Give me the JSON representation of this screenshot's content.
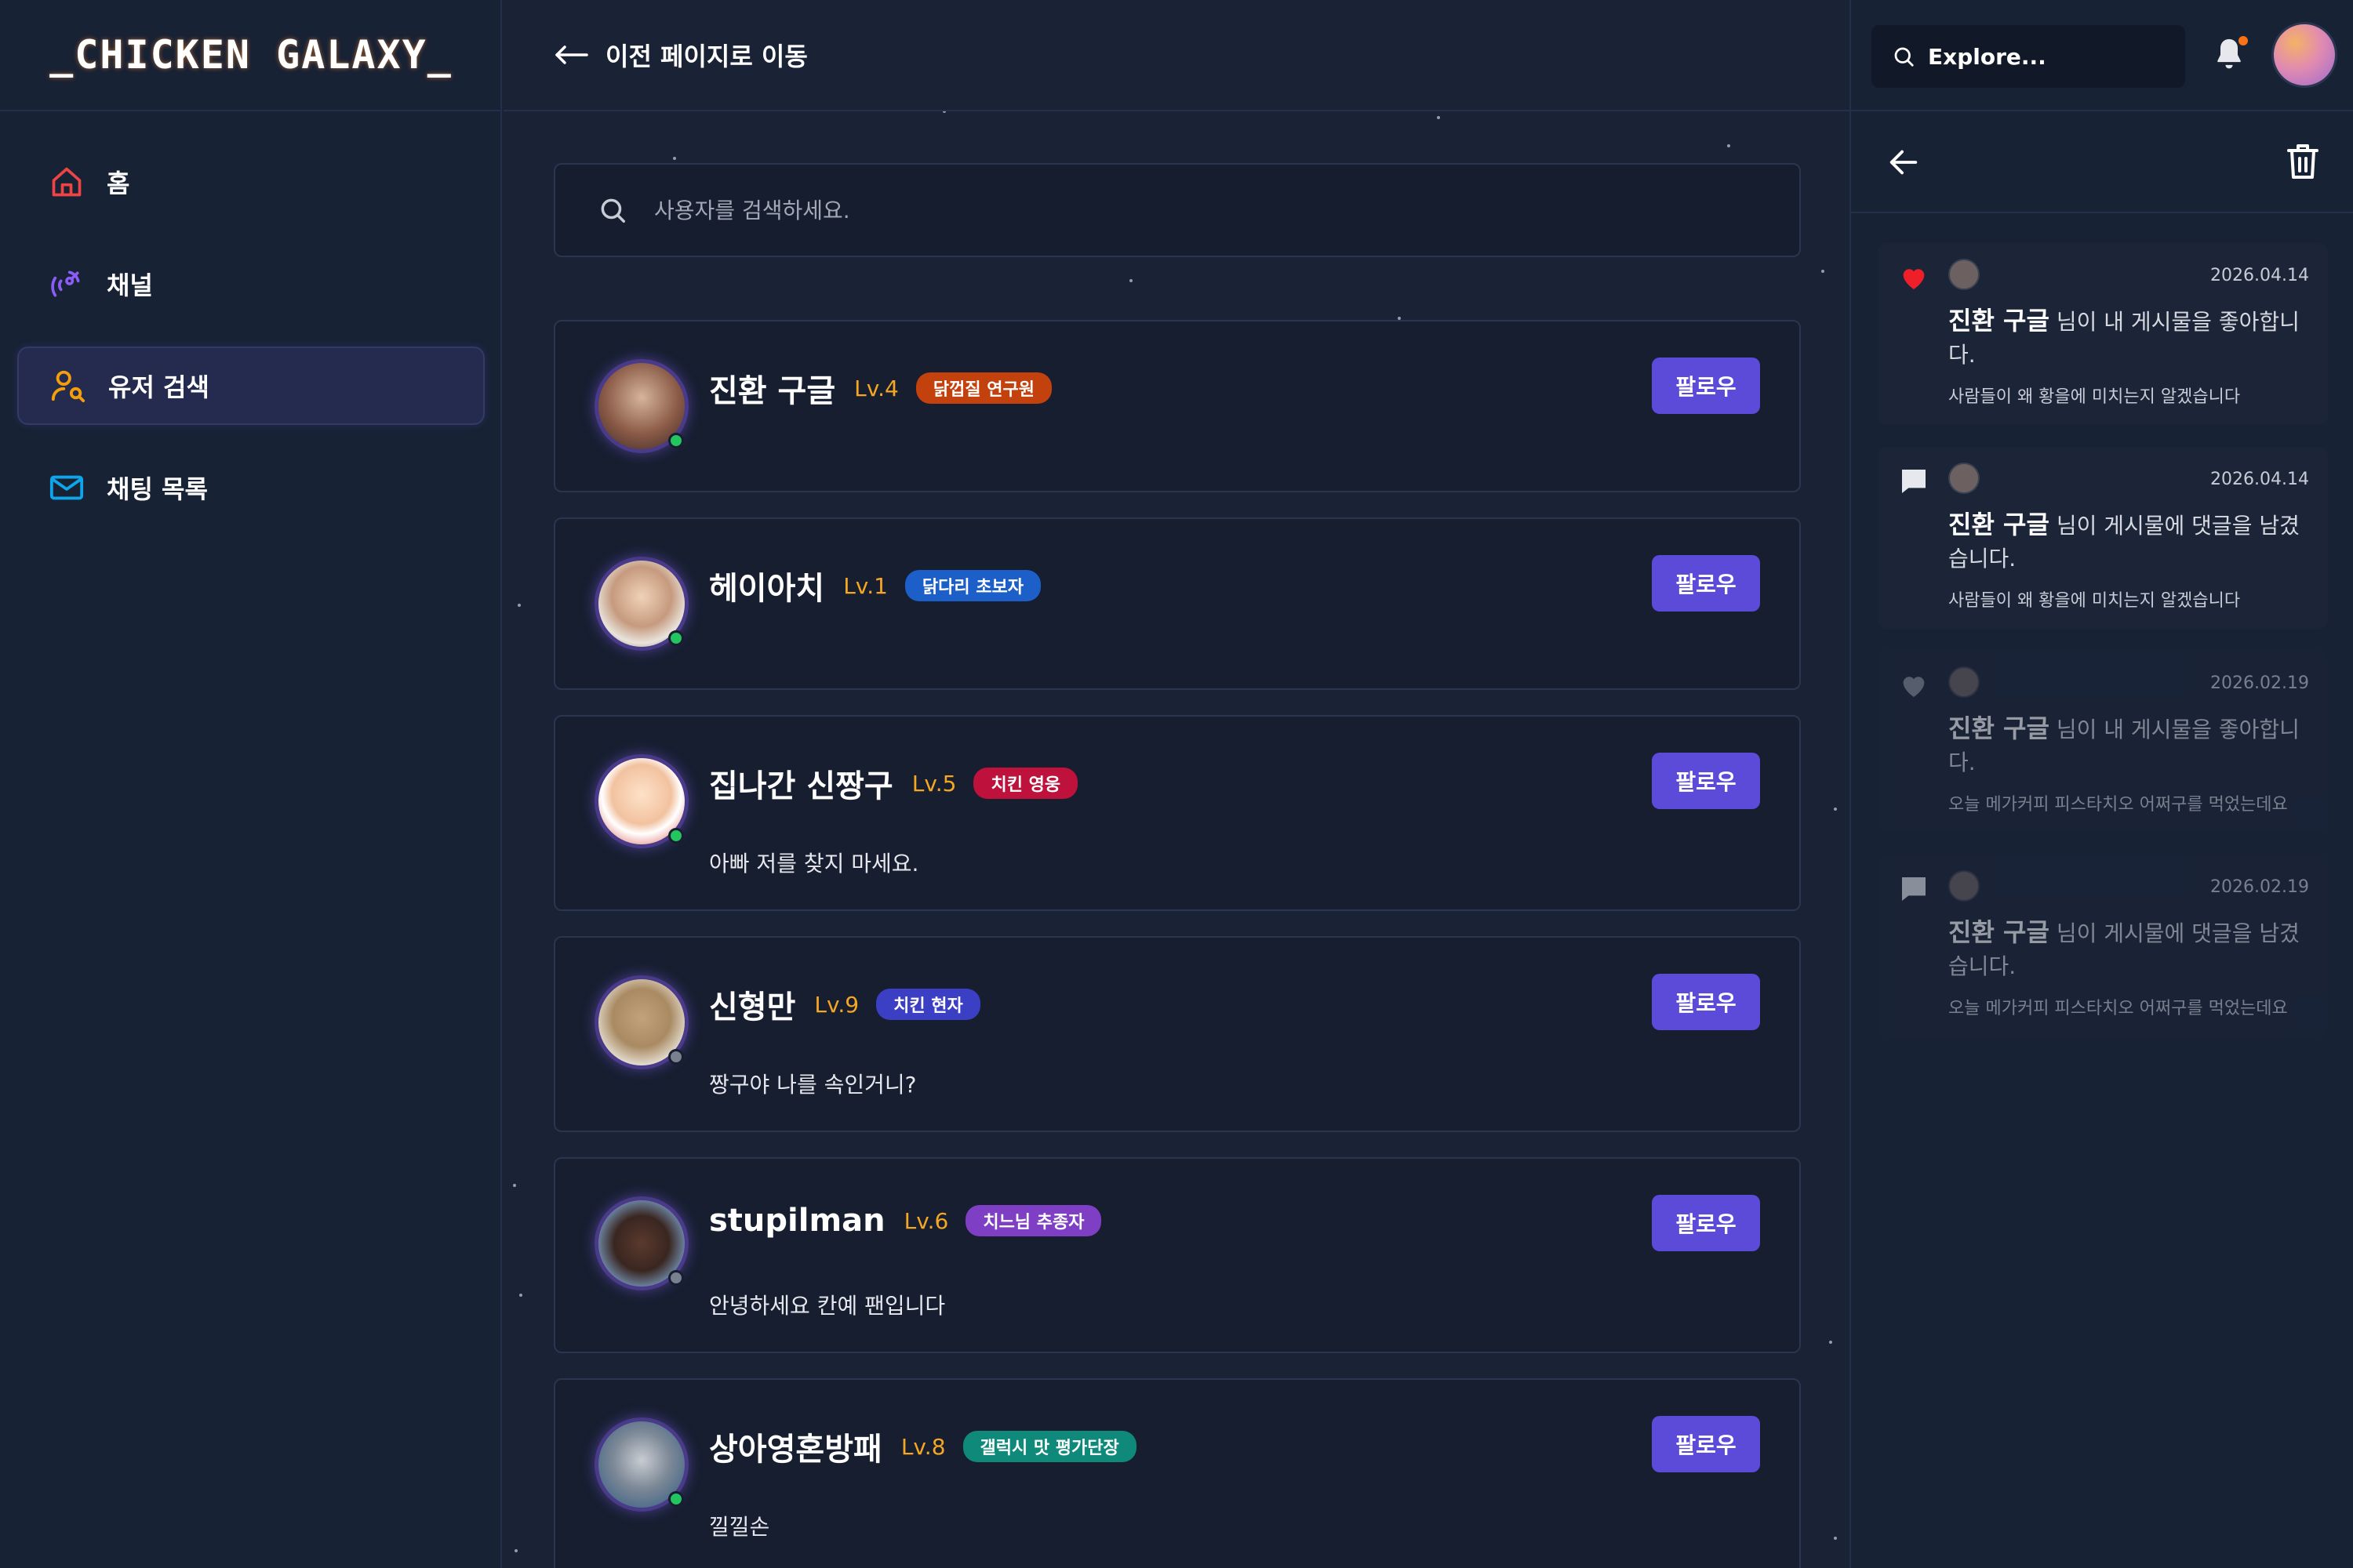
{
  "app": {
    "logo": "_CHICKEN GALAXY_"
  },
  "sidebar": {
    "items": [
      {
        "label": "홈",
        "icon": "home-icon"
      },
      {
        "label": "채널",
        "icon": "satellite-icon"
      },
      {
        "label": "유저 검색",
        "icon": "user-search-icon",
        "active": true
      },
      {
        "label": "채팅 목록",
        "icon": "mail-icon"
      }
    ]
  },
  "header": {
    "back_label": "이전 페이지로 이동"
  },
  "search": {
    "placeholder": "사용자를 검색하세요."
  },
  "users": [
    {
      "name": "진환 구글",
      "level": "Lv.4",
      "badge": "닭껍질 연구원",
      "badge_color": "#c2410c",
      "bio": "",
      "status": "online",
      "follow_label": "팔로우"
    },
    {
      "name": "헤이아치",
      "level": "Lv.1",
      "badge": "닭다리 초보자",
      "badge_color": "#1d5fc9",
      "bio": "",
      "status": "online",
      "follow_label": "팔로우"
    },
    {
      "name": "집나간 신짱구",
      "level": "Lv.5",
      "badge": "치킨 영웅",
      "badge_color": "#be123c",
      "bio": "아빠 저를 찾지 마세요.",
      "status": "online",
      "follow_label": "팔로우"
    },
    {
      "name": "신형만",
      "level": "Lv.9",
      "badge": "치킨 현자",
      "badge_color": "#3b3fc4",
      "bio": "짱구야 나를 속인거니?",
      "status": "offline",
      "follow_label": "팔로우"
    },
    {
      "name": "stupilman",
      "level": "Lv.6",
      "badge": "치느님 추종자",
      "badge_color": "#7e3fc4",
      "bio": "안녕하세요 칸예 팬입니다",
      "status": "offline",
      "follow_label": "팔로우"
    },
    {
      "name": "상아영혼방패",
      "level": "Lv.8",
      "badge": "갤럭시 맛 평가단장",
      "badge_color": "#0f8a7a",
      "bio": "낄낄손",
      "status": "online",
      "follow_label": "팔로우"
    }
  ],
  "topbar": {
    "explore_placeholder": "Explore..."
  },
  "notifications": [
    {
      "type": "like",
      "date": "2026.04.14",
      "user": "진환 구글",
      "message": "님이 내 게시물을 좋아합니다.",
      "snippet": "사람들이 왜 황을에 미치는지 알겠습니다",
      "read": false
    },
    {
      "type": "comment",
      "date": "2026.04.14",
      "user": "진환 구글",
      "message": "님이 게시물에 댓글을 남겼습니다.",
      "snippet": "사람들이 왜 황을에 미치는지 알겠습니다",
      "read": false
    },
    {
      "type": "like",
      "date": "2026.02.19",
      "user": "진환 구글",
      "message": "님이 내 게시물을 좋아합니다.",
      "snippet": "오늘 메가커피 피스타치오 어쩌구를 먹었는데요",
      "read": true
    },
    {
      "type": "comment",
      "date": "2026.02.19",
      "user": "진환 구글",
      "message": "님이 게시물에 댓글을 남겼습니다.",
      "snippet": "오늘 메가커피 피스타치오 어쩌구를 먹었는데요",
      "read": true
    }
  ]
}
